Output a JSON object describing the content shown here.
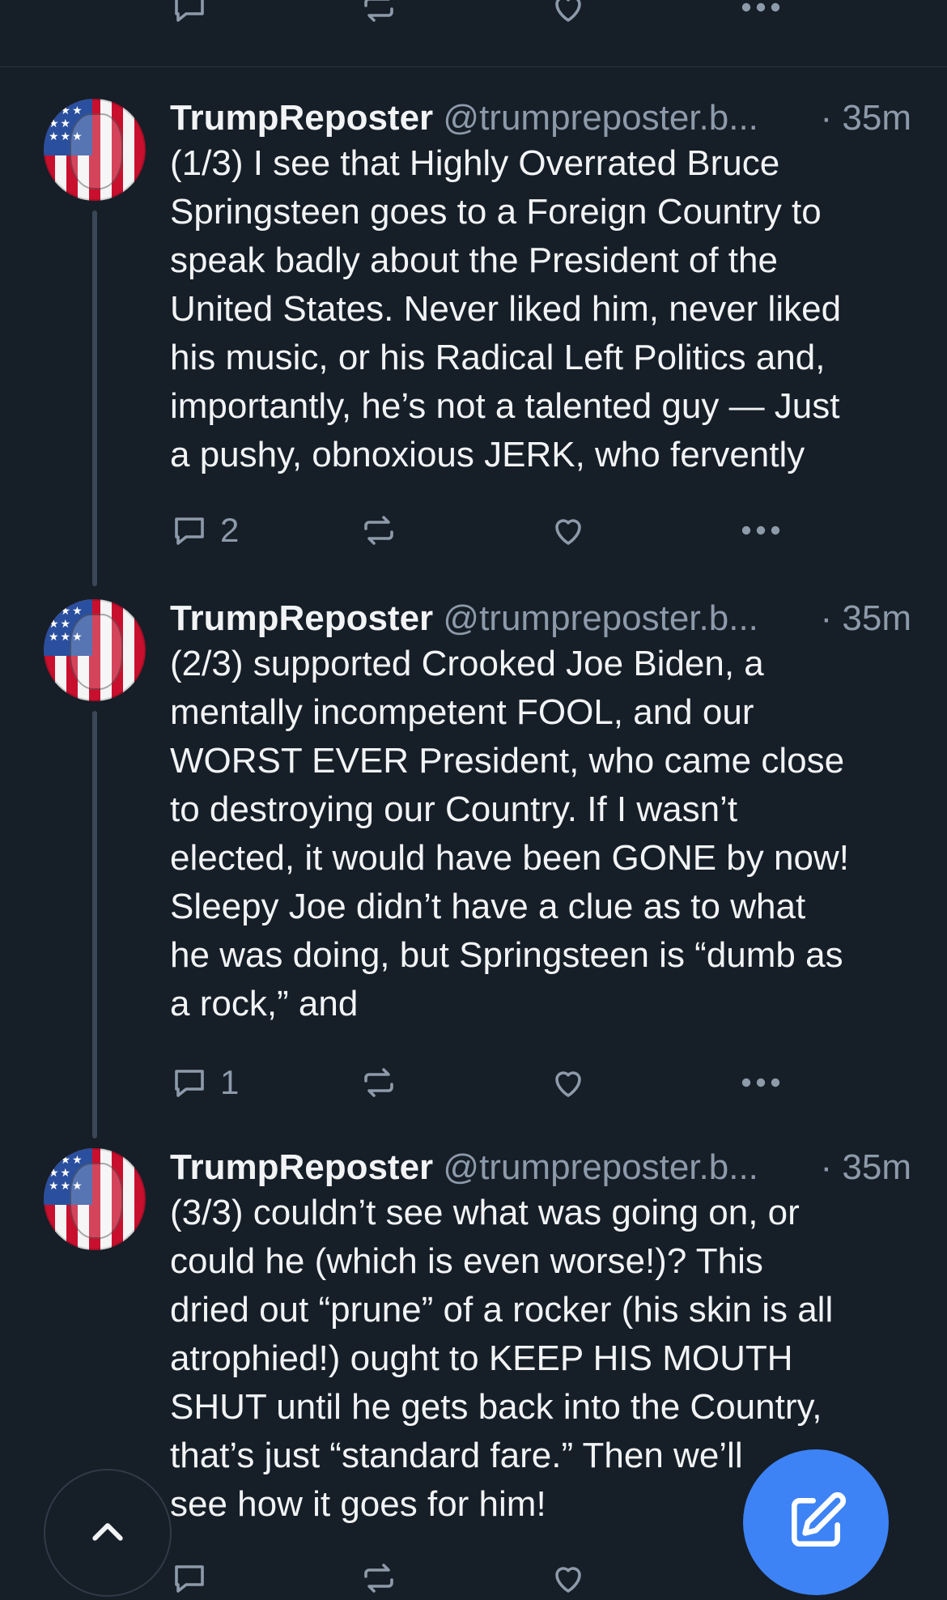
{
  "feed": {
    "previous_post_actions": {
      "reply_count": "",
      "colors": {
        "icon": "#8d9aaa"
      }
    },
    "posts": [
      {
        "display_name": "TrumpReposter",
        "handle": "@trumpreposter.b...",
        "time": "· 35m",
        "text_lines": [
          "(1/3) I see that Highly Overrated Bruce",
          "Springsteen goes to a Foreign Country to",
          "speak badly about the President of the",
          "United States. Never liked him, never liked",
          "his music, or his Radical Left Politics and,",
          "importantly, he’s not a talented guy — Just",
          "a pushy, obnoxious JERK, who fervently"
        ],
        "reply_count": "2",
        "avatar_icon": "flag-face-avatar-icon"
      },
      {
        "display_name": "TrumpReposter",
        "handle": "@trumpreposter.b...",
        "time": "· 35m",
        "text_lines": [
          "(2/3) supported Crooked Joe Biden, a",
          "mentally incompetent FOOL, and our",
          "WORST EVER President, who came close",
          "to destroying our Country. If I wasn’t",
          "elected, it would have been GONE by now!",
          "Sleepy Joe didn’t have a clue as to what",
          "he was doing, but Springsteen is “dumb as",
          "a rock,” and"
        ],
        "reply_count": "1",
        "avatar_icon": "flag-face-avatar-icon"
      },
      {
        "display_name": "TrumpReposter",
        "handle": "@trumpreposter.b...",
        "time": "· 35m",
        "text_lines": [
          "(3/3) couldn’t see what was going on, or",
          "could he (which is even worse!)? This",
          "dried out “prune” of a rocker (his skin is all",
          "atrophied!) ought to KEEP HIS MOUTH",
          "SHUT until he gets back into the Country,",
          "that’s just “standard fare.” Then we’ll",
          "see how it goes for him!"
        ],
        "reply_count": "",
        "avatar_icon": "flag-face-avatar-icon"
      }
    ]
  },
  "icons": {
    "reply": "reply-icon",
    "repost": "repost-icon",
    "like": "heart-icon",
    "more": "more-icon",
    "scroll_top": "chevron-up-icon",
    "compose": "compose-icon"
  },
  "colors": {
    "background": "#161e27",
    "text": "#f1f3f5",
    "muted": "#8d9aaa",
    "thread_line": "#3a4756",
    "compose_button": "#3d83f6"
  }
}
